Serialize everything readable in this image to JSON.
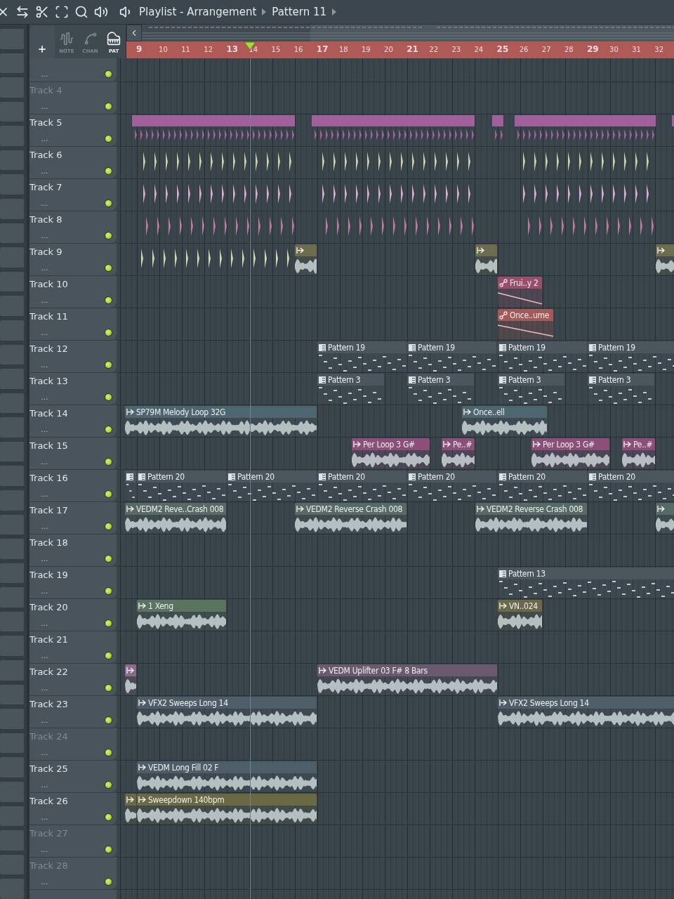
{
  "toolbar": {
    "title": "Playlist - Arrangement",
    "crumb": "Pattern 11"
  },
  "modes": [
    {
      "label": "NOTE",
      "kind": "note",
      "selected": false
    },
    {
      "label": "CHAN",
      "kind": "chan",
      "selected": false
    },
    {
      "label": "PAT",
      "kind": "pat",
      "selected": true
    }
  ],
  "ruler": {
    "marks": [
      {
        "label": "9",
        "major": true
      },
      {
        "label": "10",
        "major": false
      },
      {
        "label": "11",
        "major": false
      },
      {
        "label": "12",
        "major": false
      },
      {
        "label": "13",
        "major": true
      },
      {
        "label": "14",
        "major": false
      },
      {
        "label": "15",
        "major": false
      },
      {
        "label": "16",
        "major": false
      },
      {
        "label": "17",
        "major": true
      },
      {
        "label": "18",
        "major": false
      },
      {
        "label": "19",
        "major": false
      },
      {
        "label": "20",
        "major": false
      },
      {
        "label": "21",
        "major": true
      },
      {
        "label": "22",
        "major": false
      },
      {
        "label": "23",
        "major": false
      },
      {
        "label": "24",
        "major": false
      },
      {
        "label": "25",
        "major": true
      },
      {
        "label": "26",
        "major": false
      },
      {
        "label": "27",
        "major": false
      },
      {
        "label": "28",
        "major": false
      },
      {
        "label": "29",
        "major": true
      },
      {
        "label": "30",
        "major": false
      },
      {
        "label": "31",
        "major": false
      },
      {
        "label": "32",
        "major": false
      }
    ]
  },
  "top_track": {
    "detail": "...",
    "enabled": true
  },
  "tracks": [
    {
      "name": "Track 4",
      "detail": "...",
      "dimmed": true,
      "enabled": true
    },
    {
      "name": "Track 5",
      "detail": "...",
      "dimmed": false,
      "enabled": true,
      "clips": [
        {
          "kind": "slices",
          "color": "#a0609c"
        }
      ]
    },
    {
      "name": "Track 6",
      "detail": "...",
      "dimmed": false,
      "enabled": true,
      "clips": [
        {
          "kind": "slices",
          "color": "#cfcfa8"
        }
      ]
    },
    {
      "name": "Track 7",
      "detail": "...",
      "dimmed": false,
      "enabled": true,
      "clips": [
        {
          "kind": "slices",
          "color": "#dcaad6"
        }
      ]
    },
    {
      "name": "Track 8",
      "detail": "...",
      "dimmed": false,
      "enabled": true,
      "clips": [
        {
          "kind": "slices",
          "color": "#c07aa8"
        }
      ]
    },
    {
      "name": "Track 9",
      "detail": "...",
      "dimmed": false,
      "enabled": true,
      "clips": [
        {
          "kind": "slices",
          "color": "#d8d4b6"
        },
        {
          "kind": "audio",
          "color": "#6e6c4e"
        },
        {
          "kind": "audio",
          "color": "#6e6c4e"
        },
        {
          "kind": "audio",
          "color": "#6e6c4e"
        }
      ]
    },
    {
      "name": "Track 10",
      "detail": "...",
      "dimmed": false,
      "enabled": true,
      "clips": [
        {
          "kind": "automation",
          "name": "Frui..y 2",
          "color": "#9a4e6c"
        }
      ]
    },
    {
      "name": "Track 11",
      "detail": "...",
      "dimmed": false,
      "enabled": true,
      "clips": [
        {
          "kind": "automation",
          "name": "Once..ume",
          "color": "#a45a58"
        }
      ]
    },
    {
      "name": "Track 12",
      "detail": "...",
      "dimmed": false,
      "enabled": true,
      "clips": [
        {
          "kind": "pattern",
          "name": "Pattern 19",
          "color": "#4b565f"
        },
        {
          "kind": "pattern",
          "name": "Pattern 19",
          "color": "#4b565f"
        },
        {
          "kind": "pattern",
          "name": "Pattern 19",
          "color": "#4b565f"
        },
        {
          "kind": "pattern",
          "name": "Pattern 19",
          "color": "#4b565f"
        }
      ]
    },
    {
      "name": "Track 13",
      "detail": "...",
      "dimmed": false,
      "enabled": true,
      "clips": [
        {
          "kind": "pattern",
          "name": "Pattern 3",
          "color": "#4b565f"
        },
        {
          "kind": "pattern",
          "name": "Pattern 3",
          "color": "#4b565f"
        },
        {
          "kind": "pattern",
          "name": "Pattern 3",
          "color": "#4b565f"
        },
        {
          "kind": "pattern",
          "name": "Pattern 3",
          "color": "#4b565f"
        }
      ]
    },
    {
      "name": "Track 14",
      "detail": "...",
      "dimmed": false,
      "enabled": true,
      "clips": [
        {
          "kind": "audio",
          "name": "SP79M Melody Loop 32G",
          "color": "#4e6670"
        },
        {
          "kind": "audio",
          "name": "Once..ell",
          "color": "#4e6670"
        }
      ]
    },
    {
      "name": "Track 15",
      "detail": "...",
      "dimmed": false,
      "enabled": true,
      "clips": [
        {
          "kind": "audio",
          "name": "Per Loop 3 G#",
          "color": "#8e4e7a"
        },
        {
          "kind": "audio",
          "name": "Pe..#",
          "color": "#8e4e7a"
        },
        {
          "kind": "audio",
          "name": "Per Loop 3 G#",
          "color": "#8e4e7a"
        },
        {
          "kind": "audio",
          "name": "Pe..#",
          "color": "#8e4e7a"
        }
      ]
    },
    {
      "name": "Track 16",
      "detail": "...",
      "dimmed": false,
      "enabled": true,
      "clips": [
        {
          "kind": "pattern",
          "color": "#4b565f"
        },
        {
          "kind": "pattern",
          "name": "Pattern 20",
          "color": "#4b565f"
        },
        {
          "kind": "pattern",
          "name": "Pattern 20",
          "color": "#4b565f"
        },
        {
          "kind": "pattern",
          "name": "Pattern 20",
          "color": "#4b565f"
        },
        {
          "kind": "pattern",
          "name": "Pattern 20",
          "color": "#4b565f"
        },
        {
          "kind": "pattern",
          "name": "Pattern 20",
          "color": "#4b565f"
        },
        {
          "kind": "pattern",
          "name": "Pattern 20",
          "color": "#4b565f"
        }
      ]
    },
    {
      "name": "Track 17",
      "detail": "...",
      "dimmed": false,
      "enabled": true,
      "clips": [
        {
          "kind": "audio",
          "name": "VEDM2 Reve..Crash 008",
          "color": "#586a64"
        },
        {
          "kind": "audio",
          "name": "VEDM2 Reverse Crash 008",
          "color": "#586a64"
        },
        {
          "kind": "audio",
          "name": "VEDM2 Reverse Crash 008",
          "color": "#586a64"
        },
        {
          "kind": "audio",
          "color": "#586a64"
        }
      ]
    },
    {
      "name": "Track 18",
      "detail": "...",
      "dimmed": false,
      "enabled": true
    },
    {
      "name": "Track 19",
      "detail": "...",
      "dimmed": false,
      "enabled": true,
      "clips": [
        {
          "kind": "pattern",
          "name": "Pattern 13",
          "color": "#4b565f"
        }
      ]
    },
    {
      "name": "Track 20",
      "detail": "...",
      "dimmed": false,
      "enabled": true,
      "clips": [
        {
          "kind": "audio",
          "name": "1 Xeng",
          "color": "#5a7460"
        },
        {
          "kind": "audio",
          "name": "VN..024",
          "color": "#6a694a"
        }
      ]
    },
    {
      "name": "Track 21",
      "detail": "...",
      "dimmed": false,
      "enabled": true
    },
    {
      "name": "Track 22",
      "detail": "...",
      "dimmed": false,
      "enabled": true,
      "clips": [
        {
          "kind": "audio",
          "color": "#8c6a8a"
        },
        {
          "kind": "audio",
          "name": "VEDM Uplifter 03 F# 8 Bars",
          "color": "#6a5a70"
        }
      ]
    },
    {
      "name": "Track 23",
      "detail": "...",
      "dimmed": false,
      "enabled": true,
      "clips": [
        {
          "kind": "audio",
          "name": "VFX2 Sweeps Long 14",
          "color": "#4e5e68"
        },
        {
          "kind": "audio",
          "name": "VFX2 Sweeps Long 14",
          "color": "#4e5e68"
        }
      ]
    },
    {
      "name": "Track 24",
      "detail": "...",
      "dimmed": true,
      "enabled": true
    },
    {
      "name": "Track 25",
      "detail": "...",
      "dimmed": false,
      "enabled": true,
      "clips": [
        {
          "kind": "audio",
          "name": "VEDM Long Fill 02 F",
          "color": "#4e5e68"
        }
      ]
    },
    {
      "name": "Track 26",
      "detail": "...",
      "dimmed": false,
      "enabled": true,
      "clips": [
        {
          "kind": "audio",
          "color": "#6a6944"
        },
        {
          "kind": "audio",
          "name": "Sweepdown 140bpm",
          "color": "#6a6944"
        }
      ]
    },
    {
      "name": "Track 27",
      "detail": "...",
      "dimmed": true,
      "enabled": true
    },
    {
      "name": "Track 28",
      "detail": "...",
      "dimmed": true,
      "enabled": true
    }
  ]
}
